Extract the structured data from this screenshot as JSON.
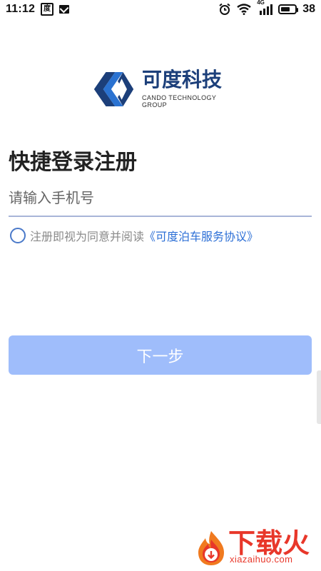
{
  "status_bar": {
    "time": "11:12",
    "app_icon_glyph": "度",
    "network_label": "4G",
    "battery_text": "38",
    "icons": [
      "app-icon",
      "mail-icon",
      "alarm-icon",
      "wifi-icon",
      "signal-icon",
      "battery-icon"
    ]
  },
  "logo": {
    "name_cn": "可度科技",
    "name_en": "CANDO TECHNOLOGY GROUP",
    "colors": {
      "primary": "#1c3f7a",
      "secondary": "#2a72d1"
    }
  },
  "page": {
    "title": "快捷登录注册",
    "phone_placeholder": "请输入手机号",
    "agreement_text": "注册即视为同意并阅读",
    "agreement_link": "《可度泊车服务协议》",
    "next_button": "下一步"
  },
  "watermark": {
    "brand": "下载火",
    "url": "xiazaihuo.com"
  },
  "colors": {
    "accent": "#2c6fd6",
    "button_disabled": "#9fbdfb",
    "underline": "#a8b5d8",
    "watermark": "#e8372a"
  }
}
